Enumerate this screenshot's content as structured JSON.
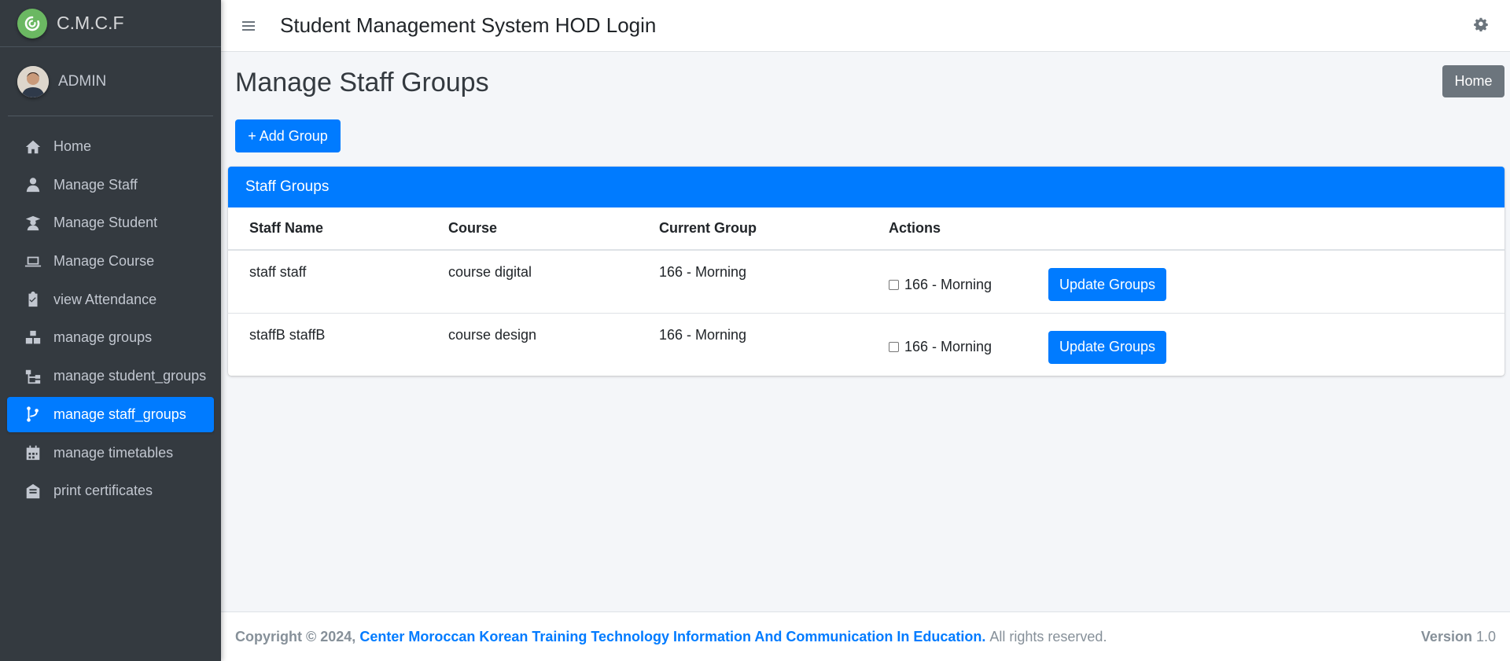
{
  "brand": {
    "name": "C.M.C.F"
  },
  "user": {
    "name": "ADMIN"
  },
  "sidebar": {
    "items": [
      {
        "label": "Home",
        "icon": "home-icon",
        "active": false
      },
      {
        "label": "Manage Staff",
        "icon": "user-tie-icon",
        "active": false
      },
      {
        "label": "Manage Student",
        "icon": "user-graduate-icon",
        "active": false
      },
      {
        "label": "Manage Course",
        "icon": "laptop-icon",
        "active": false
      },
      {
        "label": "view Attendance",
        "icon": "clipboard-check-icon",
        "active": false
      },
      {
        "label": "manage groups",
        "icon": "cubes-icon",
        "active": false
      },
      {
        "label": "manage student_groups",
        "icon": "sitemap-icon",
        "active": false
      },
      {
        "label": "manage staff_groups",
        "icon": "code-branch-icon",
        "active": true
      },
      {
        "label": "manage timetables",
        "icon": "calendar-icon",
        "active": false
      },
      {
        "label": "print certificates",
        "icon": "envelope-open-text-icon",
        "active": false
      }
    ]
  },
  "header": {
    "title": "Student Management System HOD Login"
  },
  "main": {
    "page_title": "Manage Staff Groups",
    "home_button": "Home",
    "add_button": "+ Add Group",
    "card_title": "Staff Groups",
    "columns": [
      "Staff Name",
      "Course",
      "Current Group",
      "Actions"
    ],
    "rows": [
      {
        "staff_name": "staff staff",
        "course": "course digital",
        "current_group": "166 - Morning",
        "option": "166 - Morning",
        "checked": false,
        "action_label": "Update Groups"
      },
      {
        "staff_name": "staffB staffB",
        "course": "course design",
        "current_group": "166 - Morning",
        "option": "166 - Morning",
        "checked": false,
        "action_label": "Update Groups"
      }
    ]
  },
  "footer": {
    "copyright": "Copyright © 2024,",
    "organization": "Center Moroccan Korean Training Technology Information And Communication In Education.",
    "rights": "All rights reserved.",
    "version_label": "Version",
    "version_value": "1.0"
  },
  "colors": {
    "primary": "#007bff",
    "sidebar": "#343a40",
    "secondary": "#6c757d"
  }
}
